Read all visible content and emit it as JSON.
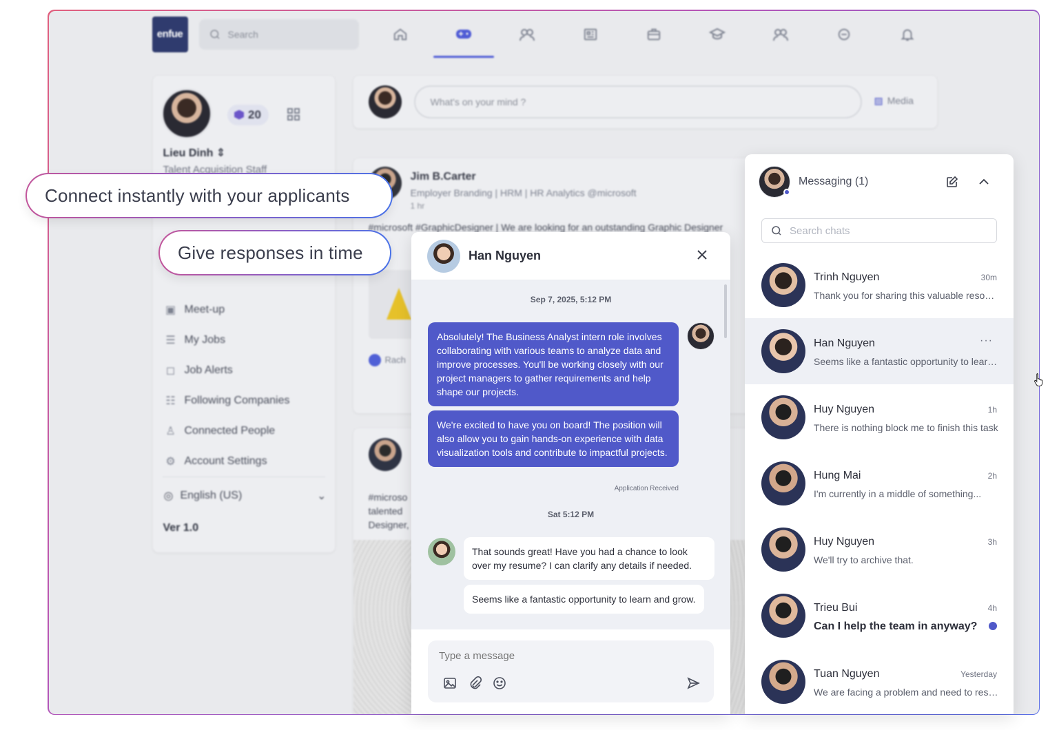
{
  "callouts": {
    "primary": "Connect instantly with your applicants",
    "secondary": "Give responses in time"
  },
  "background_app": {
    "logo_text": "enfue",
    "search_placeholder": "Search",
    "nav_icons": [
      "home-icon",
      "gamepad-icon",
      "people-icon",
      "newspaper-icon",
      "briefcase-icon",
      "graduation-cap-icon",
      "group-icon",
      "chat-bubble-icon",
      "bell-icon"
    ],
    "active_nav": "gamepad-icon",
    "profile": {
      "name": "Lieu Dinh",
      "role": "Talent Acquisition Staff",
      "points": "20"
    },
    "menu": [
      {
        "label": "Meet-up",
        "icon": "calendar-icon"
      },
      {
        "label": "My Jobs",
        "icon": "list-icon"
      },
      {
        "label": "Job Alerts",
        "icon": "alert-icon"
      },
      {
        "label": "Following Companies",
        "icon": "following-icon"
      },
      {
        "label": "Connected People",
        "icon": "user-plus-icon"
      },
      {
        "label": "Account Settings",
        "icon": "gear-icon"
      }
    ],
    "language": "English (US)",
    "version": "Ver 1.0",
    "composer": {
      "placeholder": "What's on your mind ?",
      "media_label": "Media"
    },
    "post1": {
      "author": "Jim B.Carter",
      "subtitle": "Employer Branding | HRM | HR Analytics @microsoft",
      "time": "1 hr",
      "text": "#microsoft #GraphicDesigner | We are looking for an outstanding Graphic Designer",
      "reaction_name": "Rach"
    },
    "post2": {
      "text_lines": [
        "#microso",
        "talented",
        "Designer,"
      ]
    }
  },
  "chat": {
    "contact_name": "Han Nguyen",
    "timestamp_1": "Sep 7, 2025, 5:12 PM",
    "outgoing": [
      "Absolutely! The Business Analyst intern role involves collaborating with various teams to analyze data and improve processes. You'll be working closely with our project managers to gather requirements and help shape our projects.",
      "We're excited to have you on board! The position will also allow you to gain hands-on experience with data visualization tools and contribute to impactful projects."
    ],
    "status_note": "Application Received",
    "timestamp_2": "Sat 5:12 PM",
    "incoming": [
      "That sounds great! Have you had a chance to look over my resume? I can clarify any details if needed.",
      "Seems like a fantastic opportunity to learn and grow."
    ],
    "input_placeholder": "Type a message"
  },
  "messaging": {
    "title": "Messaging (1)",
    "search_placeholder": "Search chats",
    "conversations": [
      {
        "name": "Trinh Nguyen",
        "preview": "Thank you for sharing this valuable resource",
        "time": "30m",
        "selected": false,
        "unread": false
      },
      {
        "name": "Han Nguyen",
        "preview": "Seems like a fantastic opportunity to learn and grow.",
        "time": "",
        "selected": true,
        "unread": false
      },
      {
        "name": "Huy Nguyen",
        "preview": "There is nothing block me to finish this task",
        "time": "1h",
        "selected": false,
        "unread": false
      },
      {
        "name": "Hung Mai",
        "preview": "I'm currently in a middle of something...",
        "time": "2h",
        "selected": false,
        "unread": false
      },
      {
        "name": "Huy Nguyen",
        "preview": "We'll try to archive that.",
        "time": "3h",
        "selected": false,
        "unread": false
      },
      {
        "name": "Trieu Bui",
        "preview": "Can I help the team in anyway?",
        "time": "4h",
        "selected": false,
        "unread": true
      },
      {
        "name": "Tuan Nguyen",
        "preview": "We are facing a problem and need to resolve it",
        "time": "Yesterday",
        "selected": false,
        "unread": false
      }
    ]
  },
  "colors": {
    "accent": "#5059c9",
    "callout_gradient_start": "#c2579c",
    "callout_gradient_end": "#4a73e8"
  }
}
